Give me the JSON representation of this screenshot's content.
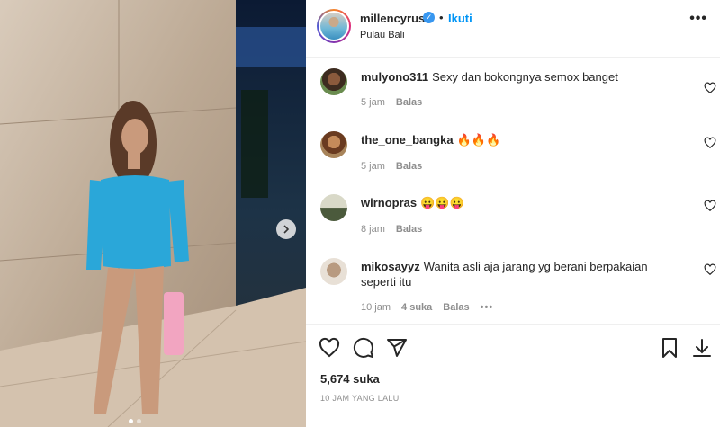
{
  "post": {
    "username": "millencyrus",
    "separator": "•",
    "follow_label": "Ikuti",
    "location": "Pulau Bali",
    "more_label": "•••",
    "verified_mark": "✓"
  },
  "comments": [
    {
      "username": "mulyono311",
      "text": "Sexy dan bokongnya semox banget",
      "time": "5 jam",
      "reply": "Balas"
    },
    {
      "username": "the_one_bangka",
      "text": "🔥🔥🔥",
      "time": "5 jam",
      "reply": "Balas"
    },
    {
      "username": "wirnopras",
      "text": "😛😛😛",
      "time": "8 jam",
      "reply": "Balas"
    },
    {
      "username": "mikosayyz",
      "text": "Wanita asli aja jarang yg berani berpakaian seperti itu",
      "time": "10 jam",
      "likes": "4 suka",
      "reply": "Balas",
      "options": "•••"
    }
  ],
  "footer": {
    "likes": "5,674 suka",
    "posted": "10 JAM YANG LALU"
  },
  "carousel": {
    "current": 1,
    "total": 2
  },
  "colors": {
    "accent": "#0095f6",
    "verified": "#3897f0",
    "text": "#262626",
    "muted": "#8e8e8e"
  },
  "icons": [
    "heart-icon",
    "comment-icon",
    "share-icon",
    "bookmark-icon",
    "chevron-right-icon"
  ]
}
